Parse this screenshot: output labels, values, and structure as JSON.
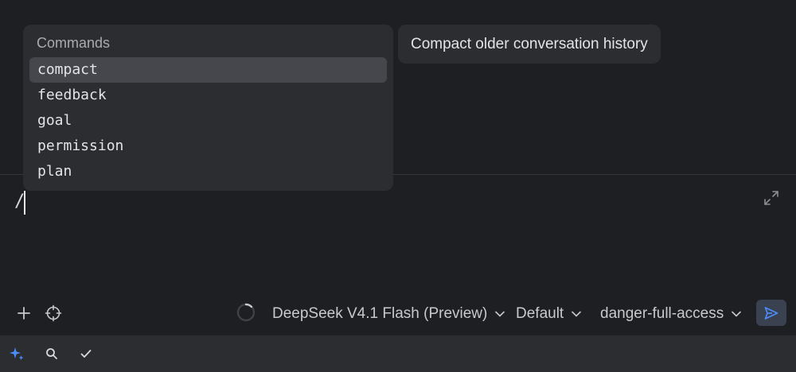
{
  "popup": {
    "title": "Commands",
    "commands": [
      "compact",
      "feedback",
      "goal",
      "permission",
      "plan"
    ],
    "selected_index": 0
  },
  "tooltip": {
    "text": "Compact older conversation history"
  },
  "input": {
    "value": "/"
  },
  "toolbar": {
    "model_label": "DeepSeek V4.1 Flash (Preview)",
    "mode_label": "Default",
    "access_label": "danger-full-access"
  },
  "icons": {
    "add": "plus-icon",
    "target": "crosshair-icon",
    "expand": "expand-icon",
    "spinner": "loading-spinner-icon",
    "send": "send-icon",
    "status": [
      "sparkle-icon",
      "search-icon",
      "check-icon"
    ]
  },
  "colors": {
    "background": "#1e1f22",
    "panel": "#2b2d31",
    "selected": "#45474c",
    "accent": "#4c8df6"
  }
}
